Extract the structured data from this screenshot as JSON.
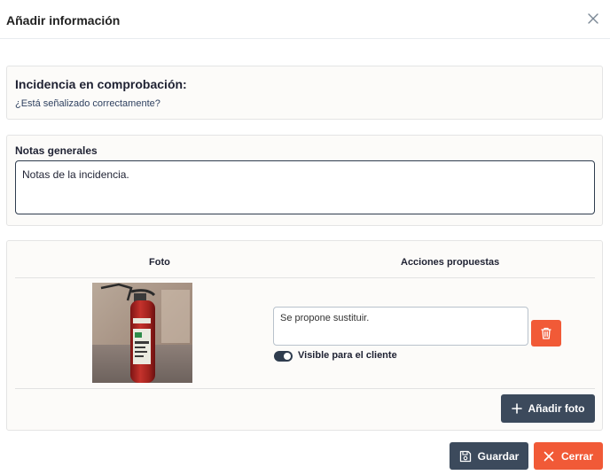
{
  "modal": {
    "title": "Añadir información"
  },
  "incidence": {
    "title": "Incidencia en comprobación:",
    "question": "¿Está señalizado correctamente?"
  },
  "notes": {
    "label": "Notas generales",
    "value": "Notas de la incidencia."
  },
  "photos_table": {
    "headers": {
      "photo": "Foto",
      "actions": "Acciones propuestas"
    },
    "rows": [
      {
        "photo_icon": "fire-extinguisher-photo",
        "proposed_action": "Se propone sustituir.",
        "visible_to_client_label": "Visible para el cliente",
        "visible_to_client": true
      }
    ],
    "add_photo_label": "Añadir foto"
  },
  "footer": {
    "save_label": "Guardar",
    "close_label": "Cerrar"
  },
  "colors": {
    "primary": "#3c4a5c",
    "danger": "#f15a37",
    "card_bg": "#fcfbf9"
  }
}
